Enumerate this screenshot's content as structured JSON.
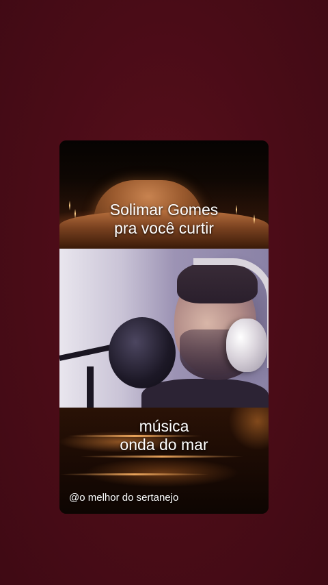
{
  "background_color": "#4a0d18",
  "post": {
    "top_caption": {
      "line1": "Solimar Gomes",
      "line2": "pra você curtir"
    },
    "bottom_caption": {
      "line1": "música",
      "line2": "onda do mar"
    },
    "watermark_handle": "@o melhor do sertanejo"
  }
}
